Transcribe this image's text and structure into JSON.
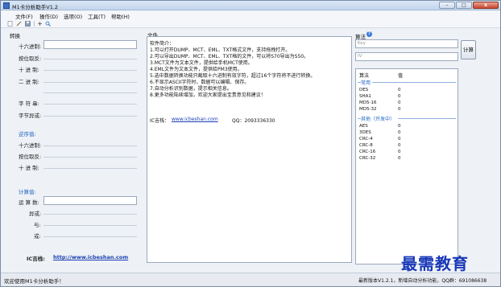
{
  "window": {
    "title": "M1卡分析助手V1.2",
    "min": "–",
    "max": "□",
    "close": "x"
  },
  "menu": [
    "文件(F)",
    "操作(D)",
    "选项(O)",
    "工具(T)",
    "帮助(H)"
  ],
  "left": {
    "convert_title": "转换",
    "hex_label": "十六进制:",
    "hex_value": "",
    "bitflip_label": "按位取反:",
    "dec_label": "十 进 制:",
    "bin_label": "二 进 制:",
    "string_label": "字 符 串:",
    "bytes_label": "字节异或:",
    "reverse_title": "逆序值:",
    "rev_hex_label": "十六进制:",
    "rev_bitflip_label": "按位取反:",
    "rev_dec_label": "十 进 制:",
    "calc_title": "计算值:",
    "operand_label": "运 算 数:",
    "xor_label": "异或:",
    "and_label": "与:",
    "or_label": "或:",
    "ic_label": "IC吉栈:",
    "ic_link": "http://www.icbeshan.com"
  },
  "middle": {
    "title": "文件",
    "lines": [
      "软件简介：",
      "1.可以打开DUMP、MCT、EML、TXT格式文件，支持拖拽打开。",
      "2.可以导出DUMP、MCT、EML、TXT格的文件，可以将S70导出为S50。",
      "3.MCT文件为文本文件，提供给手机MCT使用。",
      "4.EML文件为文本文件，提供给PM3使用。",
      "5.选中数据转换功能只截取十六进制有效字符，超过16个字符将不进行转换。",
      "6.不显示ASCII字符时，数据可以编辑、保存。",
      "7.自动分析识别数据，提示相关信息。",
      "8.更多功能陆续增加，欢迎大家提出宝贵意见和建议！"
    ],
    "site_label": "IC吉栈：",
    "site_link": "www.icbeshan.com",
    "qq": "QQ：2093336330"
  },
  "right": {
    "title": "算法",
    "key_placeholder": "Key",
    "iv_placeholder": "IV",
    "calc_button": "计算",
    "col_algo": "算法",
    "col_value": "值",
    "group_common": "常用",
    "common": [
      {
        "name": "DES",
        "value": "0"
      },
      {
        "name": "SHA1",
        "value": "0"
      },
      {
        "name": "MD5-16",
        "value": "0"
      },
      {
        "name": "MD5-32",
        "value": "0"
      }
    ],
    "group_other": "其他（开发中）",
    "other": [
      {
        "name": "AES",
        "value": "0"
      },
      {
        "name": "3DES",
        "value": "0"
      },
      {
        "name": "CRC-4",
        "value": "0"
      },
      {
        "name": "CRC-8",
        "value": "0"
      },
      {
        "name": "CRC-16",
        "value": "0"
      },
      {
        "name": "CRC-32",
        "value": "0"
      }
    ]
  },
  "status": {
    "left": "欢迎使用M1卡分析助手！",
    "right": "最新版本V1.2.1，新增自动分析功能，QQ群：691086638"
  },
  "watermark": "最需教育",
  "icons": [
    "app-icon",
    "new-file-icon",
    "edit-icon",
    "save-icon",
    "zoom-in-icon",
    "search-icon",
    "help-icon"
  ]
}
